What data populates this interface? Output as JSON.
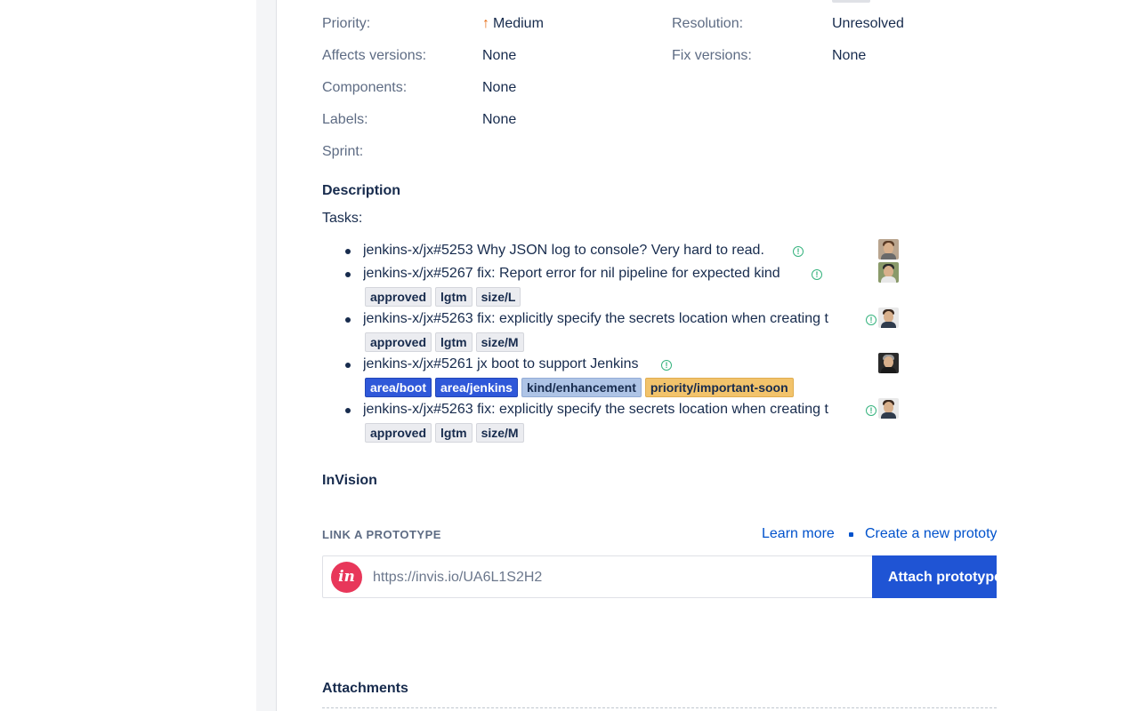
{
  "fields": {
    "priority": {
      "label": "Priority:",
      "value": "Medium",
      "icon": "arrow-up-icon"
    },
    "resolution": {
      "label": "Resolution:",
      "value": "Unresolved"
    },
    "affects_versions": {
      "label": "Affects versions:",
      "value": "None"
    },
    "fix_versions": {
      "label": "Fix versions:",
      "value": "None"
    },
    "components": {
      "label": "Components:",
      "value": "None"
    },
    "labels": {
      "label": "Labels:",
      "value": "None"
    },
    "sprint": {
      "label": "Sprint:",
      "value": ""
    }
  },
  "description": {
    "title": "Description",
    "intro": "Tasks:",
    "tasks": [
      {
        "text": "jenkins-x/jx#5253 Why JSON log to console? Very hard to read.",
        "labels": []
      },
      {
        "text": "jenkins-x/jx#5267 fix: Report error for nil pipeline for expected kind",
        "labels": [
          "approved",
          "lgtm",
          "size/L"
        ]
      },
      {
        "text": "jenkins-x/jx#5263 fix: explicitly specify the secrets location when creating t",
        "labels": [
          "approved",
          "lgtm",
          "size/M"
        ]
      },
      {
        "text": "jenkins-x/jx#5261 jx boot to support Jenkins",
        "labels": [
          "area/boot",
          "area/jenkins",
          "kind/enhancement",
          "priority/important-soon"
        ]
      },
      {
        "text": "jenkins-x/jx#5263 fix: explicitly specify the secrets location when creating t",
        "labels": [
          "approved",
          "lgtm",
          "size/M"
        ]
      }
    ]
  },
  "invision": {
    "title": "InVision",
    "link_heading": "LINK A PROTOTYPE",
    "learn_more": "Learn more",
    "create_new": "Create a new prototype",
    "input_placeholder": "https://invis.io/UA6L1S2H2",
    "logo_text": "in",
    "attach_button": "Attach prototype"
  },
  "attachments": {
    "title": "Attachments"
  },
  "colors": {
    "accent": "#0052cc",
    "button": "#1f54d4",
    "priority_medium": "#e56910",
    "open_status": "#36b37e",
    "invision_brand": "#e8375a"
  }
}
